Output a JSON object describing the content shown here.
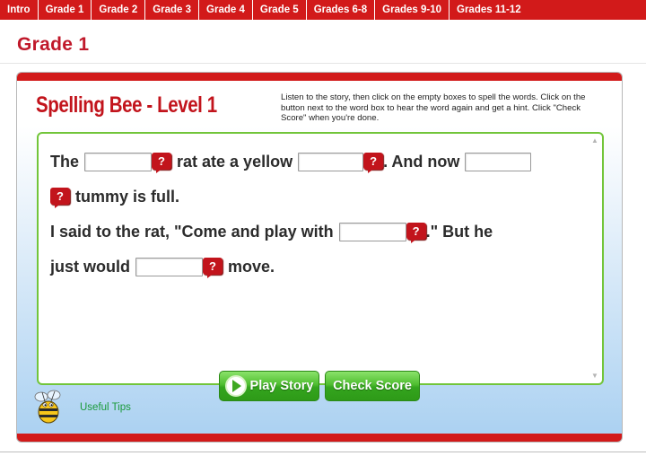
{
  "nav": {
    "tabs": [
      "Intro",
      "Grade 1",
      "Grade 2",
      "Grade 3",
      "Grade 4",
      "Grade 5",
      "Grades 6-8",
      "Grades 9-10",
      "Grades 11-12"
    ]
  },
  "page_title": "Grade 1",
  "game": {
    "title": "Spelling Bee - Level 1",
    "instructions": "Listen to the story, then click on the empty boxes to spell the words. Click on the button next to the word box to hear the word again and get a hint. Click \"Check Score\" when you're done.",
    "hint_symbol": "?",
    "story": {
      "line1_a": "The",
      "line1_b": "rat ate a yellow",
      "line1_c": ". And now",
      "line2_a": "tummy is full.",
      "line3_a": "I said to the rat, \"Come and play with",
      "line3_b": ".\" But he",
      "line4_a": "just would",
      "line4_b": "move."
    },
    "buttons": {
      "play_story": "Play Story",
      "check_score": "Check Score"
    },
    "tips_link": "Useful Tips"
  },
  "colors": {
    "nav_red": "#d21a1a",
    "title_red": "#c0182a",
    "story_border": "#72c53a",
    "button_green": "#4fbe30",
    "tips_green": "#1a9a3a"
  },
  "icons": [
    "hint-bubble-icon",
    "play-icon",
    "bee-icon",
    "scroll-up-icon",
    "scroll-down-icon"
  ]
}
